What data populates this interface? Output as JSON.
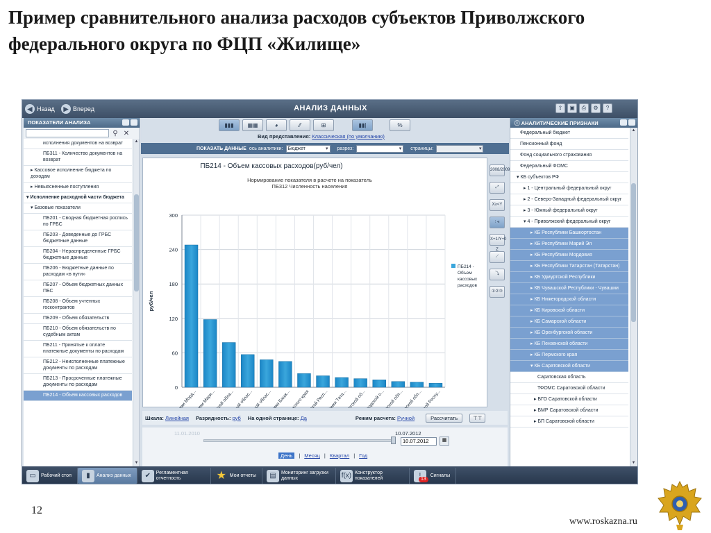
{
  "slide": {
    "title": "Пример сравнительного анализа расходов субъектов Приволжского федерального округа по ФЦП «Жилище»",
    "page_number": "12",
    "site": "www.roskazna.ru"
  },
  "app": {
    "title": "АНАЛИЗ ДАННЫХ",
    "back_label": "Назад",
    "forward_label": "Вперед"
  },
  "left_panel": {
    "header": "ПОКАЗАТЕЛИ АНАЛИЗА",
    "search_value": "",
    "items": [
      {
        "label": "исполнения документов на возврат",
        "indent": 4
      },
      {
        "label": "ПБ311 - Количество документов на возврат",
        "indent": 4
      },
      {
        "label": "▸ Кассовое исполнение бюджета по доходам",
        "indent": 1
      },
      {
        "label": "▸ Невыясненные поступления",
        "indent": 1
      },
      {
        "label": "▾ Исполнение расходной части бюджета",
        "indent": 0,
        "bold": true
      },
      {
        "label": "▾ Базовые показатели",
        "indent": 1
      },
      {
        "label": "ПБ201 - Сводная бюджетная роспись по ГРБС",
        "indent": 4
      },
      {
        "label": "ПБ203 - Доведенные до ГРБС бюджетные данные",
        "indent": 4
      },
      {
        "label": "ПБ204 - Нераспределенные ГРБС бюджетные данные",
        "indent": 4
      },
      {
        "label": "ПБ206 - Бюджетные данные по расходам «в пути»",
        "indent": 4
      },
      {
        "label": "ПБ207 - Объем бюджетных данных ПБС",
        "indent": 4
      },
      {
        "label": "ПБ208 - Объем учтенных госконтрактов",
        "indent": 4
      },
      {
        "label": "ПБ209 - Объем обязательств",
        "indent": 4
      },
      {
        "label": "ПБ210 - Объем обязательств по судебным актам",
        "indent": 4
      },
      {
        "label": "ПБ211 - Принятые к оплате платежные документы по расходам",
        "indent": 4
      },
      {
        "label": "ПБ212 - Неисполненные платежные документы по расходам",
        "indent": 4
      },
      {
        "label": "ПБ213 - Просроченные платежные документы по расходам",
        "indent": 4
      },
      {
        "label": "ПБ214 - Объем кассовых расходов",
        "indent": 4,
        "selected": true
      }
    ]
  },
  "center": {
    "view_buttons": [
      "▮▮▮",
      "▦▦",
      "◕",
      "⁄⁄",
      "⊞"
    ],
    "extra_buttons": [
      "▮▮|",
      "%"
    ],
    "presentation_label": "Вид представления:",
    "presentation_value": "Классическая (по умолчанию)",
    "filter": {
      "show_data": "ПОКАЗАТЬ ДАННЫЕ",
      "axis_label": "ось аналитики:",
      "axis_value": "Бюджет",
      "cut_label": "разрез:",
      "cut_value": "",
      "pages_label": "страницы:",
      "pages_value": ""
    },
    "side_tools": [
      "2008/2009",
      "⤢",
      "X≥<Y",
      "⫶ ⫷",
      "X+1/Y+0 Z",
      "⟋",
      "⤵",
      "①②③"
    ],
    "footer": {
      "scale_label": "Шкала:",
      "scale_value": "Линейная",
      "digits_label": "Разрядность:",
      "digits_value": "руб",
      "per_page_label": "На одной странице:",
      "per_page_value": "Да",
      "calc_mode_label": "Режим расчета:",
      "calc_mode_value": "Ручной",
      "calc_button": "Рассчитать"
    },
    "timeline": {
      "start_date": "11.01.2010",
      "end_date": "10.07.2012",
      "input_value": "10.07.2012",
      "periods": [
        "День",
        "Месяц",
        "Квартал",
        "Год"
      ],
      "active_period": "День"
    }
  },
  "chart_data": {
    "type": "bar",
    "title": "ПБ214 - Объем кассовых расходов(руб/чел)",
    "subtitle": "Нормирование показателя в расчете на показатель ПБ312 Численность населения",
    "ylabel": "руб/чел",
    "ylim": [
      0,
      300
    ],
    "yticks": [
      0,
      60,
      120,
      180,
      240,
      300
    ],
    "grid": true,
    "legend_position": "right",
    "categories": [
      "КБ Республики Морд...",
      "КБ Республики Мари...",
      "КБ Пензенской обла...",
      "КБ Кировской облас...",
      "КБ Самарской облас...",
      "КБ Республики Башк...",
      "КБ Пермского края",
      "КБ Удмуртской Респ...",
      "КБ Республики Тата...",
      "КБ Оренбургской об...",
      "КБ Нижегородской о...",
      "КБ Ульяновской обл...",
      "КБ Саратовской обл...",
      "КБ Чувашской Респу..."
    ],
    "series": [
      {
        "name": "ПБ214 - Объем кассовых расходов",
        "values": [
          248,
          118,
          78,
          57,
          48,
          45,
          24,
          20,
          17,
          15,
          13,
          10,
          9,
          7
        ]
      }
    ],
    "bar_color": "#3aa6dc"
  },
  "right_panel": {
    "header": "АНАЛИТИЧЕСКИЕ ПРИЗНАКИ",
    "items": [
      {
        "label": "Федеральный бюджет",
        "indent": 2
      },
      {
        "label": "Пенсионный фонд",
        "indent": 2
      },
      {
        "label": "Фонд социального страхования",
        "indent": 2
      },
      {
        "label": "Федеральный ФОМС",
        "indent": 2
      },
      {
        "label": "▾ КБ субъектов РФ",
        "indent": 1
      },
      {
        "label": "▸ 1 - Центральный федеральный округ",
        "indent": 3
      },
      {
        "label": "▸ 2 - Северо-Западный федеральный округ",
        "indent": 3
      },
      {
        "label": "▸ 3 - Южный федеральный округ",
        "indent": 3
      },
      {
        "label": "▾ 4 - Приволжский федеральный округ",
        "indent": 3
      },
      {
        "label": "▸ КБ Республики Башкортостан",
        "indent": 5,
        "hl": true
      },
      {
        "label": "▸ КБ Республики Марий Эл",
        "indent": 5,
        "hl": true
      },
      {
        "label": "▸ КБ Республики Мордовия",
        "indent": 5,
        "hl": true
      },
      {
        "label": "▸ КБ Республики Татарстан (Татарстан)",
        "indent": 5,
        "hl": true
      },
      {
        "label": "▸ КБ Удмуртской Республики",
        "indent": 5,
        "hl": true
      },
      {
        "label": "▸ КБ Чувашской Республики - Чувашии",
        "indent": 5,
        "hl": true
      },
      {
        "label": "▸ КБ Нижегородской области",
        "indent": 5,
        "hl": true
      },
      {
        "label": "▸ КБ Кировской области",
        "indent": 5,
        "hl": true
      },
      {
        "label": "▸ КБ Самарской области",
        "indent": 5,
        "hl": true
      },
      {
        "label": "▸ КБ Оренбургской области",
        "indent": 5,
        "hl": true
      },
      {
        "label": "▸ КБ Пензенской области",
        "indent": 5,
        "hl": true
      },
      {
        "label": "▸ КБ Пермского края",
        "indent": 5,
        "hl": true
      },
      {
        "label": "▾ КБ Саратовской области",
        "indent": 5,
        "hl": true
      },
      {
        "label": "Саратовская область",
        "indent": 7
      },
      {
        "label": "ТФОМС Саратовской области",
        "indent": 7
      },
      {
        "label": "▸ БГО Саратовской области",
        "indent": 6
      },
      {
        "label": "▸ БМР Саратовской области",
        "indent": 6
      },
      {
        "label": "▸ БП Саратовской области",
        "indent": 6
      }
    ]
  },
  "taskbar": [
    {
      "label": "Рабочий стол",
      "icon": "desktop-icon",
      "glyph": "▭",
      "active": false
    },
    {
      "label": "Анализ данных",
      "icon": "analysis-icon",
      "glyph": "▮",
      "active": true
    },
    {
      "label": "Регламентная отчетность",
      "icon": "report-icon",
      "glyph": "✔",
      "active": false
    },
    {
      "label": "Мои отчеты",
      "icon": "star-icon",
      "glyph": "★",
      "active": false
    },
    {
      "label": "Мониторинг загрузки данных",
      "icon": "monitor-icon",
      "glyph": "▤",
      "active": false
    },
    {
      "label": "Конструктор показателей",
      "icon": "formula-icon",
      "glyph": "f(x)",
      "active": false
    },
    {
      "label": "Сигналы",
      "icon": "signals-icon",
      "glyph": "!",
      "active": false,
      "badge": "13"
    }
  ]
}
